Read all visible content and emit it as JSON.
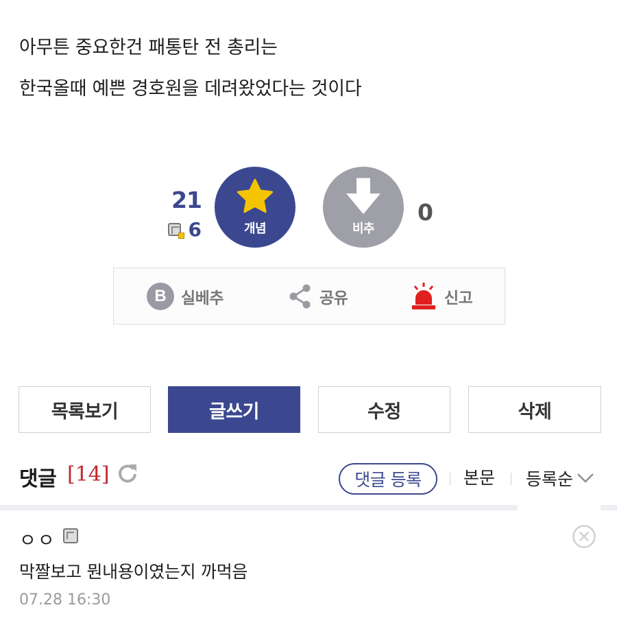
{
  "post": {
    "lines": [
      "아무튼 중요한건 패통탄 전 총리는",
      "한국올때 예쁜 경호원을 데려왔었다는 것이다"
    ]
  },
  "vote": {
    "up_count": "21",
    "fix_count": "6",
    "up_label": "개념",
    "down_label": "비추",
    "down_count": "0"
  },
  "actions": {
    "best": {
      "badge": "B",
      "label": "실베추"
    },
    "share": {
      "label": "공유"
    },
    "report": {
      "label": "신고"
    }
  },
  "buttons": {
    "list": "목록보기",
    "write": "글쓰기",
    "edit": "수정",
    "delete": "삭제"
  },
  "comments": {
    "title": "댓글",
    "count": "[14]",
    "register": "댓글 등록",
    "body_link": "본문",
    "sort": "등록순",
    "items": [
      {
        "user": "ㅇㅇ",
        "text": "막짤보고 뭔내용이였는지 까먹음",
        "date": "07.28 16:30"
      }
    ]
  },
  "colors": {
    "brand": "#3b4890",
    "downvote": "#9f9fa8",
    "count_red": "#c0282d",
    "star": "#f5c400",
    "report_red": "#e0201f"
  }
}
